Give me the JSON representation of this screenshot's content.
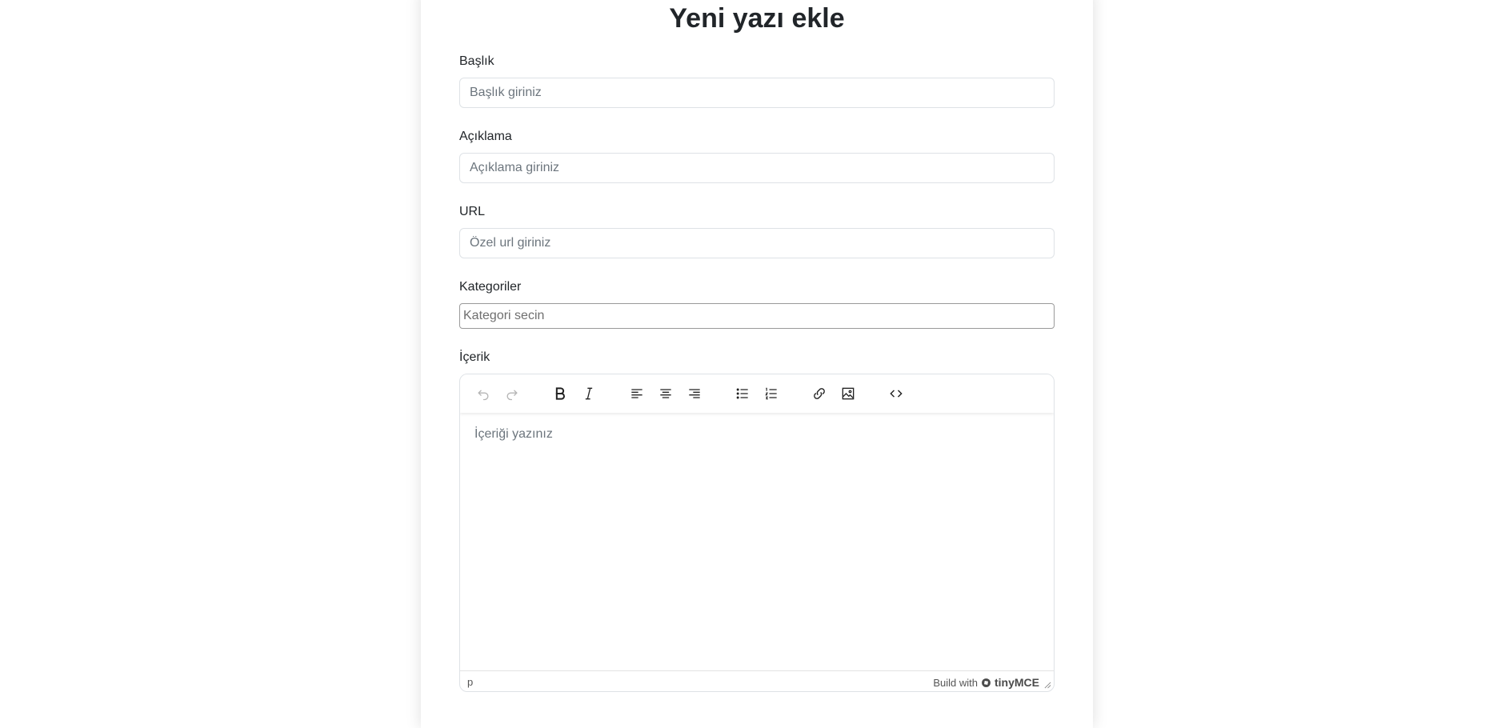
{
  "page": {
    "title": "Yeni yazı ekle"
  },
  "form": {
    "title_field": {
      "label": "Başlık",
      "placeholder": "Başlık giriniz"
    },
    "description_field": {
      "label": "Açıklama",
      "placeholder": "Açıklama giriniz"
    },
    "url_field": {
      "label": "URL",
      "placeholder": "Özel url giriniz"
    },
    "category_field": {
      "label": "Kategoriler",
      "placeholder": "Kategori secin"
    },
    "content_field": {
      "label": "İçerik"
    }
  },
  "editor": {
    "toolbar": [
      "undo-icon",
      "redo-icon",
      "bold-icon",
      "italic-icon",
      "align-left-icon",
      "align-center-icon",
      "align-right-icon",
      "bullet-list-icon",
      "numbered-list-icon",
      "link-icon",
      "image-icon",
      "source-code-icon"
    ],
    "placeholder": "İçeriği yazınız",
    "status_path": "p",
    "branding_prefix": "Build with",
    "branding_logo": "tinyMCE"
  }
}
